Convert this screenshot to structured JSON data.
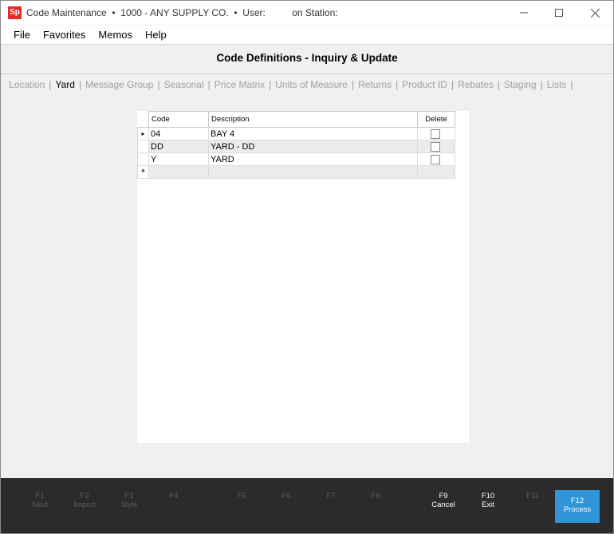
{
  "window": {
    "logo": "Sp",
    "title": "Code Maintenance  •  1000 - ANY SUPPLY CO.  •  User:          on Station:"
  },
  "menu": [
    "File",
    "Favorites",
    "Memos",
    "Help"
  ],
  "header": {
    "title": "Code Definitions - Inquiry & Update"
  },
  "tabs": [
    {
      "label": "Location",
      "active": false
    },
    {
      "label": "Yard",
      "active": true
    },
    {
      "label": "Message Group",
      "active": false
    },
    {
      "label": "Seasonal",
      "active": false
    },
    {
      "label": "Price Matrix",
      "active": false
    },
    {
      "label": "Units of Measure",
      "active": false
    },
    {
      "label": "Returns",
      "active": false
    },
    {
      "label": "Product ID",
      "active": false
    },
    {
      "label": "Rebates",
      "active": false
    },
    {
      "label": "Staging",
      "active": false
    },
    {
      "label": "Lists",
      "active": false
    }
  ],
  "grid": {
    "columns": {
      "code": "Code",
      "description": "Description",
      "delete": "Delete"
    },
    "rows": [
      {
        "code": "04",
        "description": "BAY 4",
        "delete": false,
        "current": true
      },
      {
        "code": "DD",
        "description": "YARD - DD",
        "delete": false
      },
      {
        "code": "Y",
        "description": "YARD",
        "delete": false
      }
    ],
    "new_row_marker": "*",
    "current_row_marker": "▸"
  },
  "function_keys": [
    {
      "key": "F1",
      "label": "Next",
      "enabled": false
    },
    {
      "key": "F2",
      "label": "Import",
      "enabled": false
    },
    {
      "key": "F3",
      "label": "Style",
      "enabled": false
    },
    {
      "key": "F4",
      "label": "",
      "enabled": false
    },
    {
      "key": "F5",
      "label": "",
      "enabled": false
    },
    {
      "key": "F6",
      "label": "",
      "enabled": false
    },
    {
      "key": "F7",
      "label": "",
      "enabled": false
    },
    {
      "key": "F8",
      "label": "",
      "enabled": false
    },
    {
      "key": "F9",
      "label": "Cancel",
      "enabled": true
    },
    {
      "key": "F10",
      "label": "Exit",
      "enabled": true
    },
    {
      "key": "F11",
      "label": "",
      "enabled": false
    },
    {
      "key": "F12",
      "label": "Process",
      "enabled": true,
      "primary": true
    }
  ],
  "colors": {
    "primary_button": "#2f95d8",
    "logo": "#e32b2b",
    "fbar_bg": "#2b2b2b"
  }
}
